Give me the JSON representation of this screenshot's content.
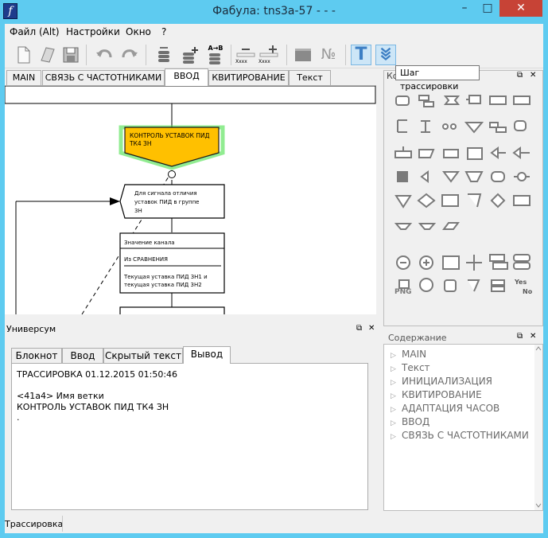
{
  "window": {
    "title": "Фабула: tns3a-57 - - -",
    "app_icon_glyph": "f",
    "minimize": "–",
    "maximize": "□",
    "close": "✕"
  },
  "menu": [
    "Файл (Alt)",
    "Настройки",
    "Окно",
    "?"
  ],
  "toolbar": {
    "icons": [
      "new-file-icon",
      "open-file-icon",
      "save-icon",
      "undo-icon",
      "redo-icon",
      "insert-stack-icon",
      "add-stack-icon",
      "rename-stack-icon",
      "remove-field-icon",
      "add-field-icon",
      "box-icon",
      "number-icon",
      "trace-icon",
      "trace-step-icon"
    ],
    "add_label": "A→B",
    "xxxx": "Xxxx",
    "number_glyph": "№",
    "trace_glyph": "T",
    "tooltip": "Шаг трассировки"
  },
  "tabs": [
    "MAIN",
    "СВЯЗЬ С ЧАСТОТНИКАМИ",
    "ВВОД",
    "КВИТИРОВАНИЕ",
    "Текст"
  ],
  "active_tab": "ВВОД",
  "diagram": {
    "node1": [
      "КОНТРОЛЬ УСТАВОК ПИД",
      "ТК4 ЗН"
    ],
    "node2": [
      "Для сигнала отличия",
      "уставок  ПИД в группе",
      "3Н"
    ],
    "node3_title": "Значение канала",
    "node3_sub": "Из СРАВНЕНИЯ",
    "node3_lines": [
      "Текущая уставка ПИД 3Н1 и",
      "текущая уставка ПИД 3Н2"
    ],
    "colors": {
      "selected_fill": "#ffc000",
      "selection": "#47e047"
    }
  },
  "palette": {
    "header_truncated": "Ко",
    "float_glyph": "⧉",
    "close_glyph": "✕",
    "png_label": "PNG",
    "yes_label": "Yes",
    "no_label": "No"
  },
  "universum": {
    "title": "Универсум",
    "tabs": [
      "Блокнот",
      "Ввод",
      "Скрытый текст",
      "Вывод"
    ],
    "active_tab": "Вывод",
    "output": [
      "ТРАССИРОВКА    01.12.2015   01:50:46",
      "",
      "<41a4>  Имя ветки",
      "КОНТРОЛЬ УСТАВОК ПИД ТК4 ЗН",
      "."
    ]
  },
  "contents": {
    "title": "Содержание",
    "items": [
      "MAIN",
      "Текст",
      "ИНИЦИАЛИЗАЦИЯ",
      "КВИТИРОВАНИЕ",
      "АДАПТАЦИЯ ЧАСОВ",
      "ВВОД",
      "СВЯЗЬ С ЧАСТОТНИКАМИ"
    ]
  },
  "status": {
    "text": "Трассировка"
  }
}
